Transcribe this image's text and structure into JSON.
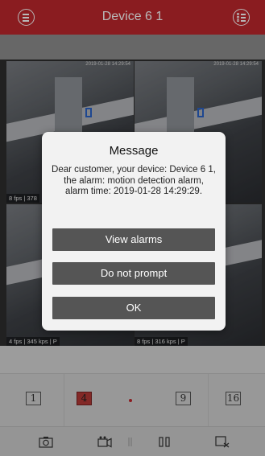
{
  "header": {
    "title": "Device 6 1",
    "menu_icon": "menu-icon",
    "list_icon": "device-list-icon",
    "background": "#c0272d"
  },
  "video": {
    "tiles": [
      {
        "timestamp": "2019-01-28 14:29:54",
        "info": "8 fps | 378"
      },
      {
        "timestamp": "2019-01-28 14:29:54",
        "info": ""
      },
      {
        "timestamp": "",
        "info": "4 fps | 345 kps | P"
      },
      {
        "timestamp": "",
        "info": "8 fps | 316 kps | P"
      }
    ]
  },
  "dialog": {
    "title": "Message",
    "message": "Dear customer, your device: Device 6 1, the alarm: motion detection alarm, alarm time: 2019-01-28 14:29:29.",
    "buttons": {
      "view_alarms": "View alarms",
      "do_not_prompt": "Do not prompt",
      "ok": "OK"
    },
    "button_color": "#555555"
  },
  "layouts": {
    "options": [
      "1",
      "4",
      "9",
      "16"
    ],
    "active": "4",
    "active_color": "#b63a37"
  },
  "toolbar": {
    "icons": [
      "camera-icon",
      "record-icon",
      "pause-icon",
      "close-window-icon"
    ]
  }
}
